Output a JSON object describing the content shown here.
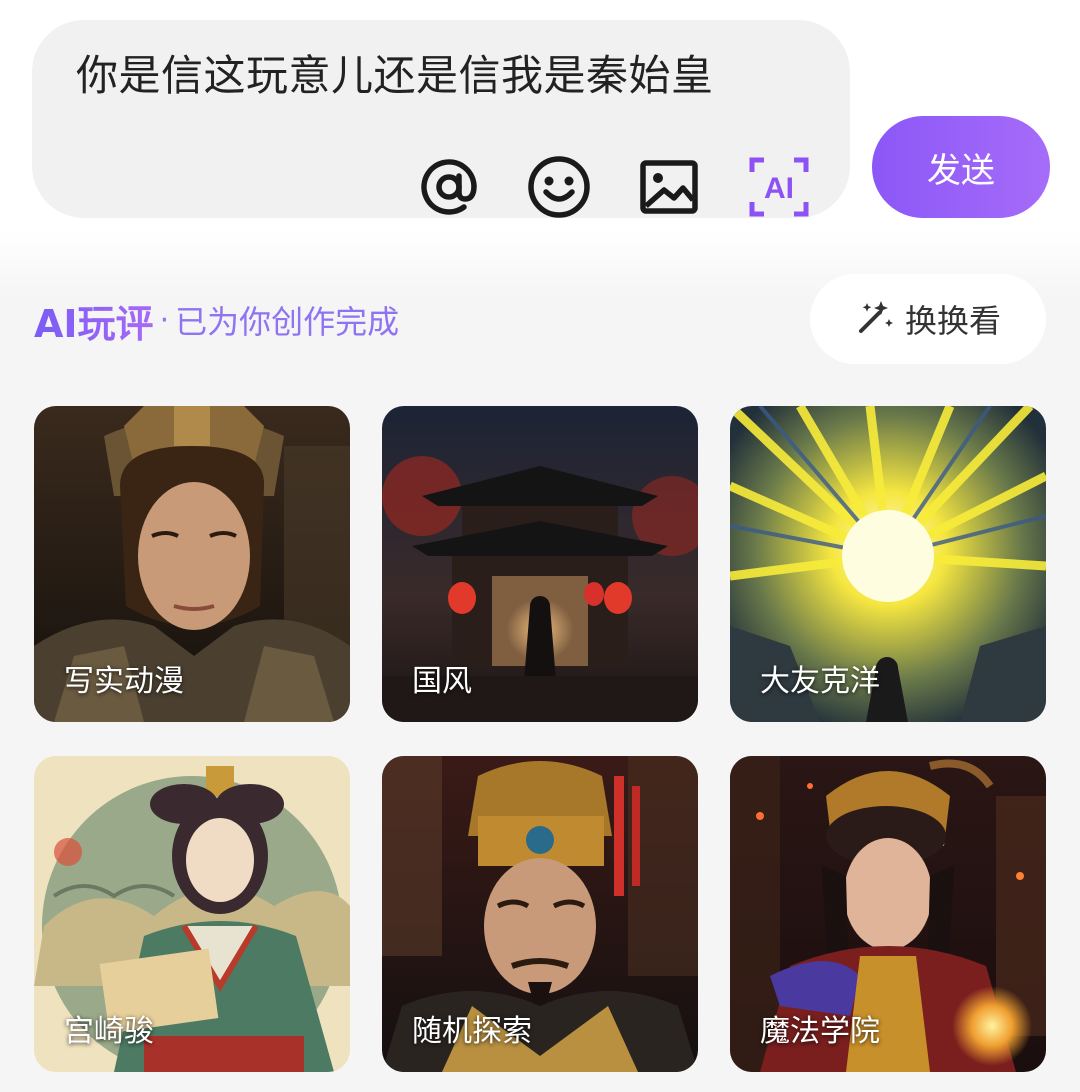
{
  "composer": {
    "text": "你是信这玩意儿还是信我是秦始皇",
    "icons": [
      "at-icon",
      "emoji-icon",
      "image-icon",
      "ai-icon"
    ],
    "ai_icon_label": "AI",
    "send_label": "发送",
    "accent_color": "#9a62f8"
  },
  "ai_review": {
    "title": "AI玩评",
    "separator": "·",
    "subtitle": "已为你创作完成",
    "refresh_label": "换换看",
    "refresh_icon": "magic-wand-icon"
  },
  "cards": [
    {
      "label": "写实动漫"
    },
    {
      "label": "国风"
    },
    {
      "label": "大友克洋"
    },
    {
      "label": "宫崎骏"
    },
    {
      "label": "随机探索"
    },
    {
      "label": "魔法学院"
    }
  ]
}
